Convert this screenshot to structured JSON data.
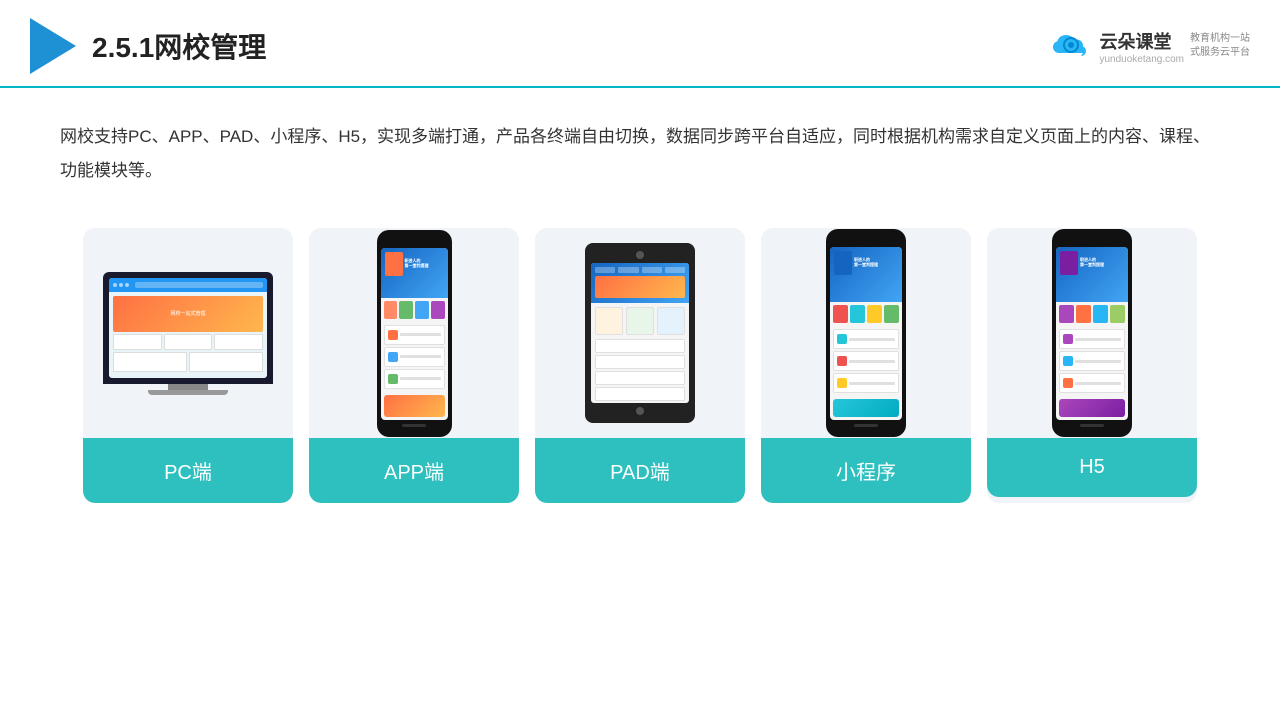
{
  "header": {
    "title": "2.5.1网校管理",
    "brand_name": "云朵课堂",
    "brand_tagline": "教育机构一站式服务云平台",
    "brand_url": "yunduoketang.com"
  },
  "description": {
    "text": "网校支持PC、APP、PAD、小程序、H5，实现多端打通，产品各终端自由切换，数据同步跨平台自适应，同时根据机构需求自定义页面上的内容、课程、功能模块等。"
  },
  "cards": [
    {
      "id": "pc",
      "label": "PC端"
    },
    {
      "id": "app",
      "label": "APP端"
    },
    {
      "id": "pad",
      "label": "PAD端"
    },
    {
      "id": "miniprogram",
      "label": "小程序"
    },
    {
      "id": "h5",
      "label": "H5"
    }
  ],
  "colors": {
    "accent": "#2ebfbf",
    "header_line": "#00b8c4",
    "card_bg": "#f0f4f8"
  }
}
